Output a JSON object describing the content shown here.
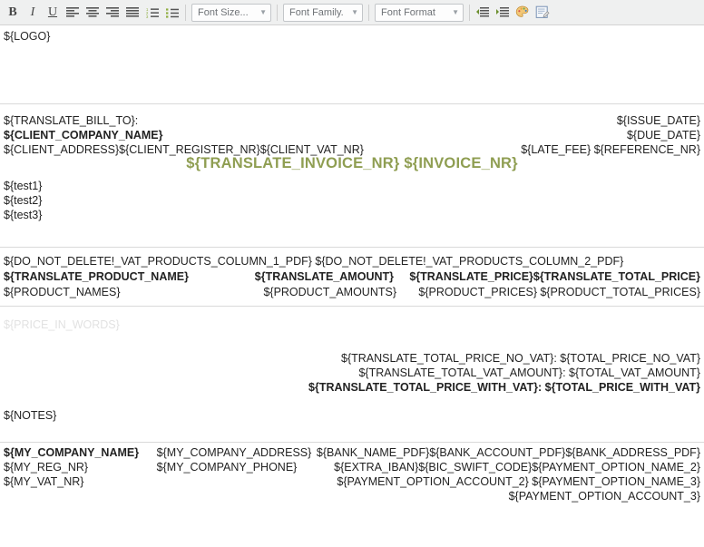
{
  "toolbar": {
    "buttons": [
      {
        "name": "bold-button",
        "label": "B",
        "title": "Bold"
      },
      {
        "name": "italic-button",
        "label": "I",
        "title": "Italic"
      },
      {
        "name": "underline-button",
        "label": "U",
        "title": "Underline"
      },
      {
        "name": "align-left-button",
        "label": "",
        "title": "Align Left"
      },
      {
        "name": "align-center-button",
        "label": "",
        "title": "Center"
      },
      {
        "name": "align-right-button",
        "label": "",
        "title": "Align Right"
      },
      {
        "name": "justify-button",
        "label": "",
        "title": "Justify"
      },
      {
        "name": "numbered-list-button",
        "label": "",
        "title": "Insert/Remove Numbered List"
      },
      {
        "name": "bulleted-list-button",
        "label": "",
        "title": "Insert/Remove Bulleted List"
      }
    ],
    "font_size": "Font Size...",
    "font_family": "Font Family.",
    "font_format": "Font Format",
    "indent_buttons": [
      {
        "name": "decrease-indent-button",
        "title": "Decrease Indent"
      },
      {
        "name": "increase-indent-button",
        "title": "Increase Indent"
      }
    ],
    "color_button": {
      "name": "text-color-button",
      "title": "Text Color"
    },
    "source_button": {
      "name": "edit-source-button",
      "title": "Edit Source"
    }
  },
  "document": {
    "logo": "${LOGO}",
    "bill_to": {
      "label": "${TRANSLATE_BILL_TO}:",
      "company_name": "${CLIENT_COMPANY_NAME}",
      "address_line": "${CLIENT_ADDRESS}${CLIENT_REGISTER_NR}${CLIENT_VAT_NR}"
    },
    "dates": {
      "issue_date": "${ISSUE_DATE}",
      "due_date": "${DUE_DATE}",
      "late_fee_reference": "${LATE_FEE} ${REFERENCE_NR}"
    },
    "invoice_title": "${TRANSLATE_INVOICE_NR} ${INVOICE_NR}",
    "invoice_title_color": "#8f9e52",
    "test_lines": [
      "${test1}",
      "${test2}",
      "${test3}"
    ],
    "products": {
      "column_markers": "${DO_NOT_DELETE!_VAT_PRODUCTS_COLUMN_1_PDF} ${DO_NOT_DELETE!_VAT_PRODUCTS_COLUMN_2_PDF}",
      "headers": [
        "${TRANSLATE_PRODUCT_NAME}",
        "${TRANSLATE_AMOUNT}",
        "${TRANSLATE_PRICE}",
        "${TRANSLATE_TOTAL_PRICE}"
      ],
      "values": [
        "${PRODUCT_NAMES}",
        "${PRODUCT_AMOUNTS}",
        "${PRODUCT_PRICES}",
        "${PRODUCT_TOTAL_PRICES}"
      ]
    },
    "price_in_words": "${PRICE_IN_WORDS}",
    "price_in_words_color": "#e2e2e2",
    "totals": {
      "no_vat": "${TRANSLATE_TOTAL_PRICE_NO_VAT}: ${TOTAL_PRICE_NO_VAT}",
      "vat_amount": "${TRANSLATE_TOTAL_VAT_AMOUNT}: ${TOTAL_VAT_AMOUNT}",
      "with_vat": "${TRANSLATE_TOTAL_PRICE_WITH_VAT}: ${TOTAL_PRICE_WITH_VAT}"
    },
    "notes": "${NOTES}",
    "footer": {
      "col_a": [
        "${MY_COMPANY_NAME}",
        "${MY_REG_NR}",
        "${MY_VAT_NR}"
      ],
      "col_b": [
        "${MY_COMPANY_ADDRESS}",
        "${MY_COMPANY_PHONE}"
      ],
      "col_c": [
        "${BANK_NAME_PDF}${BANK_ACCOUNT_PDF}${BANK_ADDRESS_PDF}",
        "${EXTRA_IBAN}${BIC_SWIFT_CODE}${PAYMENT_OPTION_NAME_2}",
        "${PAYMENT_OPTION_ACCOUNT_2} ${PAYMENT_OPTION_NAME_3}",
        "${PAYMENT_OPTION_ACCOUNT_3}"
      ]
    }
  }
}
